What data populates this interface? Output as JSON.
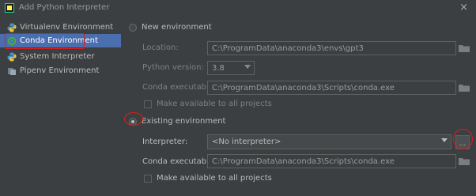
{
  "window": {
    "title": "Add Python Interpreter",
    "close_icon": "×"
  },
  "sidebar": {
    "items": [
      {
        "label": "Virtualenv Environment",
        "icon": "python-icon"
      },
      {
        "label": "Conda Environment",
        "icon": "conda-icon",
        "selected": true
      },
      {
        "label": "System Interpreter",
        "icon": "python-icon"
      },
      {
        "label": "Pipenv Environment",
        "icon": "pipenv-icon"
      }
    ]
  },
  "new_env": {
    "radio_label": "New environment",
    "location_label": "Location:",
    "location_value": "C:\\ProgramData\\anaconda3\\envs\\gpt3",
    "python_version_label": "Python version:",
    "python_version_value": "3.8",
    "conda_exe_label": "Conda executable:",
    "conda_exe_value": "C:\\ProgramData\\anaconda3\\Scripts\\conda.exe",
    "make_available_label": "Make available to all projects"
  },
  "existing_env": {
    "radio_label": "Existing environment",
    "interpreter_label": "Interpreter:",
    "interpreter_value": "<No interpreter>",
    "more_button": "...",
    "conda_exe_label": "Conda executable:",
    "conda_exe_value": "C:\\ProgramData\\anaconda3\\Scripts\\conda.exe",
    "make_available_label": "Make available to all projects"
  },
  "colors": {
    "background": "#3c3f41",
    "selection": "#4b6eaf",
    "annotation": "#e01b1b"
  }
}
